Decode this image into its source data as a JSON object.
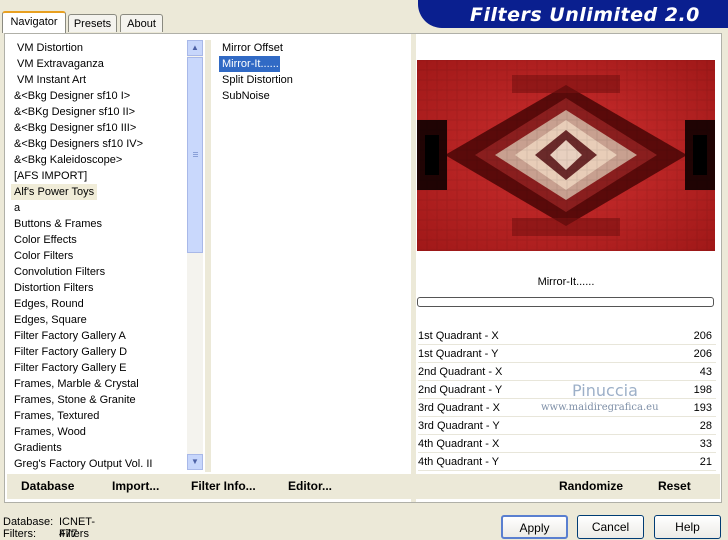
{
  "window": {
    "title": "Filters Unlimited 2.0"
  },
  "tabs": [
    "Navigator",
    "Presets",
    "About"
  ],
  "categories": [
    "VM Distortion",
    "VM Extravaganza",
    "VM Instant Art",
    "&<Bkg Designer sf10 I>",
    "&<BKg Designer sf10 II>",
    "&<Bkg Designer sf10 III>",
    "&<Bkg Designers sf10 IV>",
    "&<Bkg Kaleidoscope>",
    "[AFS IMPORT]",
    "Alf's Power Toys",
    "a",
    "Buttons & Frames",
    "Color Effects",
    "Color Filters",
    "Convolution Filters",
    "Distortion Filters",
    "Edges, Round",
    "Edges, Square",
    "Filter Factory Gallery A",
    "Filter Factory Gallery D",
    "Filter Factory Gallery E",
    "Frames, Marble & Crystal",
    "Frames, Stone & Granite",
    "Frames, Textured",
    "Frames, Wood",
    "Gradients",
    "Greg's Factory Output Vol. II"
  ],
  "filters": [
    "Mirror Offset",
    "Mirror-It......",
    "Split Distortion",
    "SubNoise"
  ],
  "preview": {
    "filter_name": "Mirror-It......"
  },
  "params": [
    {
      "label": "1st Quadrant - X",
      "value": "206"
    },
    {
      "label": "1st Quadrant - Y",
      "value": "206"
    },
    {
      "label": "2nd Quadrant - X",
      "value": "43"
    },
    {
      "label": "2nd Quadrant - Y",
      "value": "198"
    },
    {
      "label": "3rd Quadrant - X",
      "value": "193"
    },
    {
      "label": "3rd Quadrant - Y",
      "value": "28"
    },
    {
      "label": "4th Quadrant - X",
      "value": "33"
    },
    {
      "label": "4th Quadrant - Y",
      "value": "21"
    }
  ],
  "watermark": {
    "name": "Pinuccia",
    "url": "www.maidiregrafica.eu"
  },
  "left_buttons": {
    "database": "Database",
    "import": "Import...",
    "filter_info": "Filter Info...",
    "editor": "Editor..."
  },
  "right_buttons": {
    "randomize": "Randomize",
    "reset": "Reset"
  },
  "dialog_buttons": {
    "apply": "Apply",
    "cancel": "Cancel",
    "help": "Help"
  },
  "status": {
    "database_label": "Database:",
    "database_value": "ICNET-Filters",
    "filters_label": "Filters:",
    "filters_value": "477"
  },
  "colors": {
    "banner": "#0a1f8f",
    "selection": "#316ac5"
  }
}
